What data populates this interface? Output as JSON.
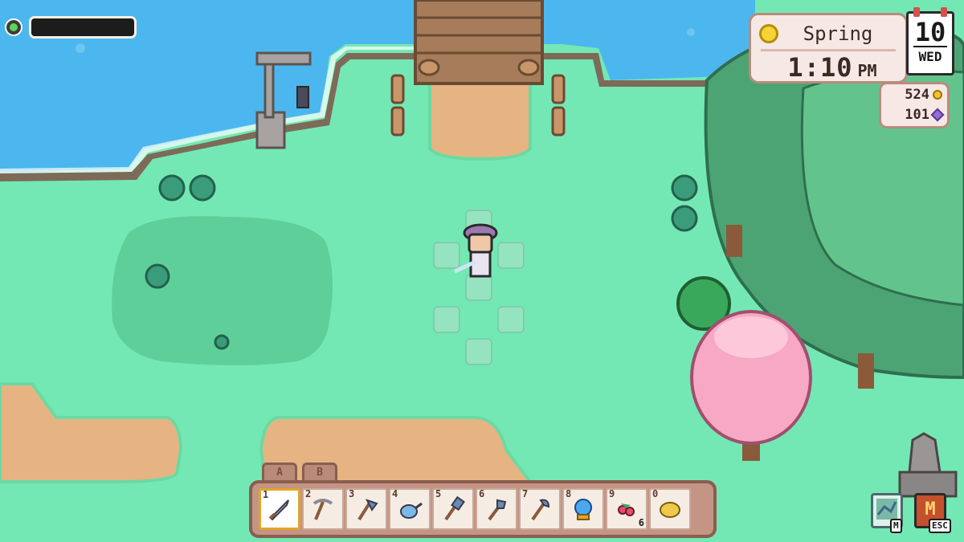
{
  "hud": {
    "energy": {
      "level": 0.0,
      "icon": "energy-orb-icon"
    },
    "season": {
      "icon": "sun-icon",
      "label": "Spring"
    },
    "clock": {
      "time": "1:10",
      "period": "PM"
    },
    "calendar": {
      "day": "10",
      "weekday": "WED"
    },
    "currency": {
      "coins": "524",
      "coin_icon": "coin-icon",
      "gems": "101",
      "gem_icon": "gem-icon"
    }
  },
  "hotbar": {
    "tabs": [
      "A",
      "B"
    ],
    "selected_index": 0,
    "slots": [
      {
        "number": "1",
        "item": "sword-icon",
        "qty": ""
      },
      {
        "number": "2",
        "item": "pickaxe-icon",
        "qty": ""
      },
      {
        "number": "3",
        "item": "axe-icon",
        "qty": ""
      },
      {
        "number": "4",
        "item": "watering-can-icon",
        "qty": ""
      },
      {
        "number": "5",
        "item": "hammer-icon",
        "qty": ""
      },
      {
        "number": "6",
        "item": "shovel-icon",
        "qty": ""
      },
      {
        "number": "7",
        "item": "hoe-icon",
        "qty": ""
      },
      {
        "number": "8",
        "item": "crystal-ball-icon",
        "qty": ""
      },
      {
        "number": "9",
        "item": "berries-icon",
        "qty": "6"
      },
      {
        "number": "0",
        "item": "hay-icon",
        "qty": ""
      }
    ]
  },
  "buttons": {
    "map": {
      "icon": "map-icon",
      "key": "M"
    },
    "menu": {
      "icon": "menu-icon",
      "key": "ESC"
    }
  },
  "colors": {
    "grass": "#74e8b4",
    "dark_grass": "#5fcf9a",
    "water": "#4bb7ee",
    "sand": "#e6b482",
    "cliff": "#7d6a58",
    "pink_tree": "#f7a8c4",
    "panel_bg": "#f6e8e4",
    "panel_border": "#b88c7c"
  }
}
